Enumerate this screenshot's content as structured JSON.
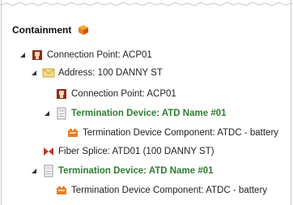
{
  "header": {
    "title": "Containment",
    "icon": "containment-icon"
  },
  "colors": {
    "accent_green": "#2e7d32",
    "icon_orange": "#e67e22",
    "splice_red": "#c0392b"
  },
  "tree": {
    "items": [
      {
        "label": "Connection Point: ACP01",
        "icon": "connection-point-icon",
        "expanded": true
      },
      {
        "label": "Address: 100 DANNY ST",
        "icon": "envelope-icon",
        "expanded": true
      },
      {
        "label": "Connection Point: ACP01",
        "icon": "connection-point-icon"
      },
      {
        "label": "Termination Device: ATD Name #01",
        "icon": "termination-device-icon",
        "expanded": true,
        "highlight": true
      },
      {
        "label": "Termination Device Component: ATDC - battery",
        "icon": "device-component-icon"
      },
      {
        "label": "Fiber Splice: ATD01 (100 DANNY ST)",
        "icon": "fiber-splice-icon"
      },
      {
        "label": "Termination Device: ATD Name #01",
        "icon": "termination-device-icon",
        "expanded": true,
        "highlight": true
      },
      {
        "label": "Termination Device Component: ATDC - battery",
        "icon": "device-component-icon"
      }
    ]
  }
}
